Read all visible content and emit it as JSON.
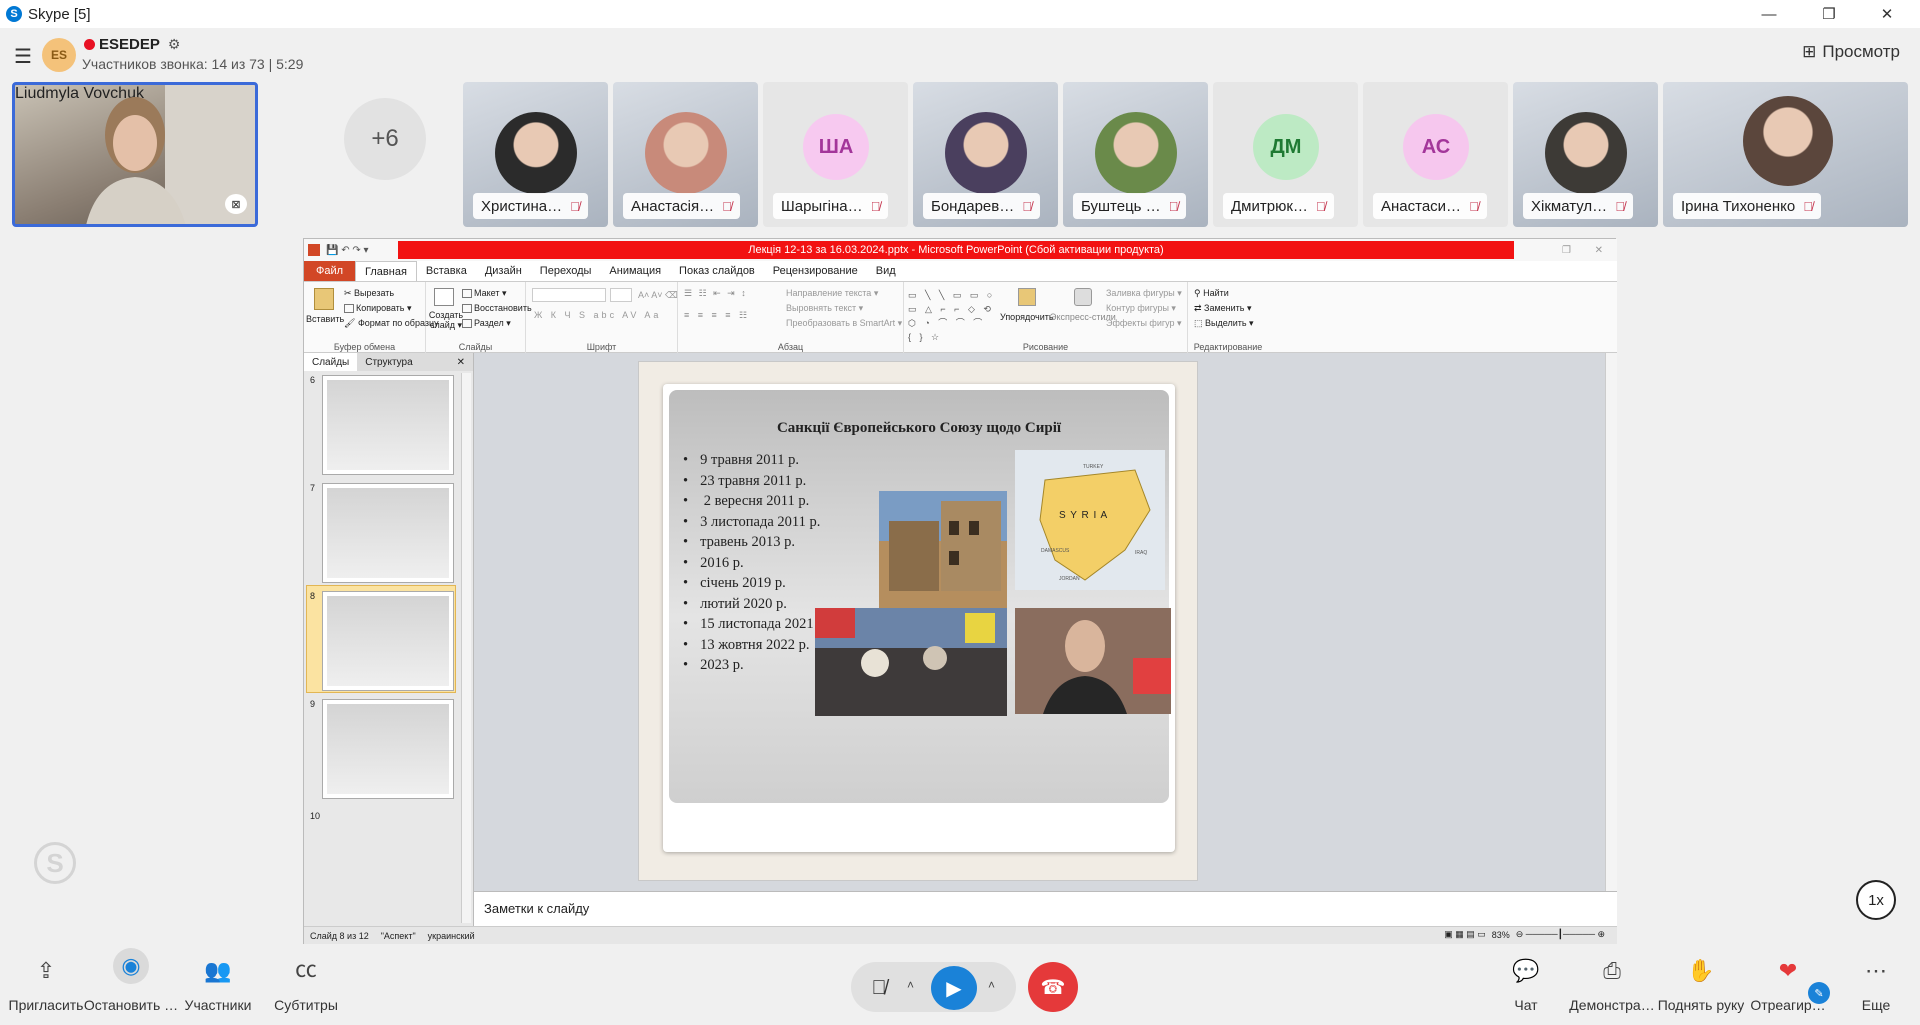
{
  "window": {
    "title": "Skype [5]",
    "minimize": "—",
    "restore": "❐",
    "close": "✕"
  },
  "call": {
    "group_initials": "ES",
    "group_name": "ESEDEP",
    "participants_line": "Участников звонка: 14 из 73 | 5:29",
    "view_label": "Просмотр",
    "self_name": "Liudmyla Vovchuk",
    "more_count": "+6",
    "participants": [
      {
        "name": "Христина…",
        "type": "photo",
        "color": "#2b2b2b"
      },
      {
        "name": "Анастасія…",
        "type": "photo",
        "color": "#c88a7a"
      },
      {
        "name": "Шарыгіна…",
        "type": "initials",
        "initials": "ША",
        "color": "#f7c9f0",
        "text_color": "#a3369a"
      },
      {
        "name": "Бондарев…",
        "type": "photo",
        "color": "#4a3f5e"
      },
      {
        "name": "Буштець …",
        "type": "photo",
        "color": "#6a8a4a"
      },
      {
        "name": "Дмитрюк…",
        "type": "initials",
        "initials": "ДМ",
        "color": "#bdeac4",
        "text_color": "#1f7a33"
      },
      {
        "name": "Анастаси…",
        "type": "initials",
        "initials": "АС",
        "color": "#f6c7ee",
        "text_color": "#a3369a"
      },
      {
        "name": "Хікматул…",
        "type": "photo",
        "color": "#3d3a36"
      },
      {
        "name": "Ірина Тихоненко",
        "type": "photo",
        "color": "#5b463c"
      }
    ]
  },
  "ppt": {
    "doc_title": "Лекція 12-13 за 16.03.2024.pptx - Microsoft PowerPoint (Сбой активации продукта)",
    "tabs": [
      "Главная",
      "Вставка",
      "Дизайн",
      "Переходы",
      "Анимация",
      "Показ слайдов",
      "Рецензирование",
      "Вид"
    ],
    "file_tab": "Файл",
    "ribbon": {
      "paste": "Вставить",
      "cut": "Вырезать",
      "copy": "Копировать ▾",
      "format_painter": "Формат по образцу",
      "clipboard_group": "Буфер обмена",
      "new_slide": "Создать слайд ▾",
      "layout": "Макет ▾",
      "reset": "Восстановить",
      "section": "Раздел ▾",
      "slides_group": "Слайды",
      "font_group": "Шрифт",
      "text_dir": "Направление текста ▾",
      "align_text": "Выровнять текст ▾",
      "smartart": "Преобразовать в SmartArt ▾",
      "paragraph_group": "Абзац",
      "arrange": "Упорядочить",
      "quick_styles": "Экспресс-стили",
      "shape_fill": "Заливка фигуры ▾",
      "shape_outline": "Контур фигуры ▾",
      "shape_effects": "Эффекты фигур ▾",
      "drawing_group": "Рисование",
      "find": "Найти",
      "replace": "Заменить ▾",
      "select": "Выделить ▾",
      "editing_group": "Редактирование"
    },
    "pane_tabs": [
      "Слайды",
      "Структура"
    ],
    "thumbs": [
      "6",
      "7",
      "8",
      "9",
      "10"
    ],
    "slide": {
      "title": "Санкції Європейського Союзу щодо Сирії",
      "items": [
        "9 травня 2011 р.",
        "23 травня 2011 р.",
        " 2 вересня 2011 р.",
        "3 листопада 2011 р.",
        "травень 2013 р.",
        "2016 р.",
        "січень 2019 р.",
        "лютий 2020 р.",
        "15 листопада 2021 р.",
        "13 жовтня 2022 р.",
        "2023 р."
      ],
      "map_label": "S Y R I A",
      "map_small": [
        "TURKEY",
        "IRAQ",
        "JORDAN",
        "DAMASCUS"
      ]
    },
    "notes": "Заметки к слайду",
    "status": {
      "slide_of": "Слайд 8 из 12",
      "theme": "\"Аспект\"",
      "lang": "украинский",
      "zoom": "83%"
    }
  },
  "speed": "1x",
  "bottom": {
    "invite": "Пригласить",
    "stop": "Остановить …",
    "participants": "Участники",
    "subtitles": "Субтитры",
    "chat": "Чат",
    "share": "Демонстра…",
    "raise": "Поднять руку",
    "react": "Отреагир…",
    "more": "Еще"
  },
  "colors": {
    "accent": "#1a82d8",
    "hangup": "#e5393a",
    "ppt_title_bg": "#f21212",
    "file_tab": "#d24726"
  }
}
